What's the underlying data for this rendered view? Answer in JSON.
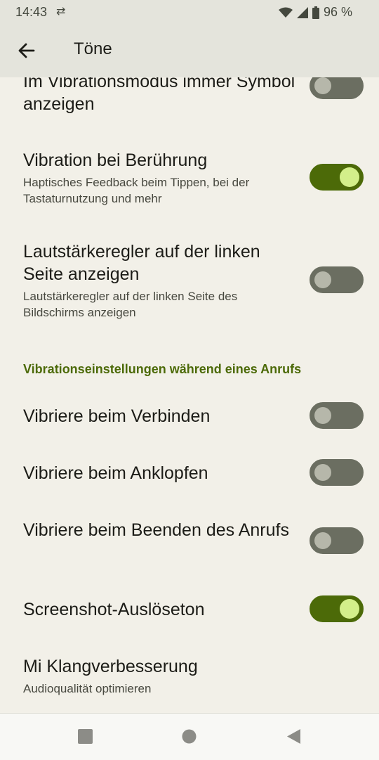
{
  "status_bar": {
    "time": "14:43",
    "battery": "96 %"
  },
  "app_bar": {
    "title": "Töne"
  },
  "rows": [
    {
      "title": "Im Vibrationsmodus immer Symbol anzeigen",
      "summary": "",
      "on": false
    },
    {
      "title": "Vibration bei Berührung",
      "summary": "Haptisches Feedback beim Tippen, bei der Tastaturnutzung und mehr",
      "on": true
    },
    {
      "title": "Lautstärkeregler auf der linken Seite anzeigen",
      "summary": "Lautstärkeregler auf der linken Seite des Bildschirms anzeigen",
      "on": false
    },
    {
      "title": "Vibriere beim Verbinden",
      "summary": "",
      "on": false
    },
    {
      "title": "Vibriere beim Anklopfen",
      "summary": "",
      "on": false
    },
    {
      "title": "Vibriere beim Beenden des Anrufs",
      "summary": "",
      "on": false
    },
    {
      "title": "Screenshot-Auslöseton",
      "summary": "",
      "on": true
    },
    {
      "title": "Mi Klangverbesserung",
      "summary": "Audioqualität optimieren"
    }
  ],
  "section_header": "Vibrationseinstellungen während eines Anrufs",
  "colors": {
    "accent": "#4c6a08",
    "background": "#f2f0e8",
    "switch_off": "#6b6e61"
  },
  "icons": {
    "back": "arrow-back-icon",
    "wifi": "wifi-icon",
    "signal": "signal-icon",
    "battery": "battery-icon"
  }
}
